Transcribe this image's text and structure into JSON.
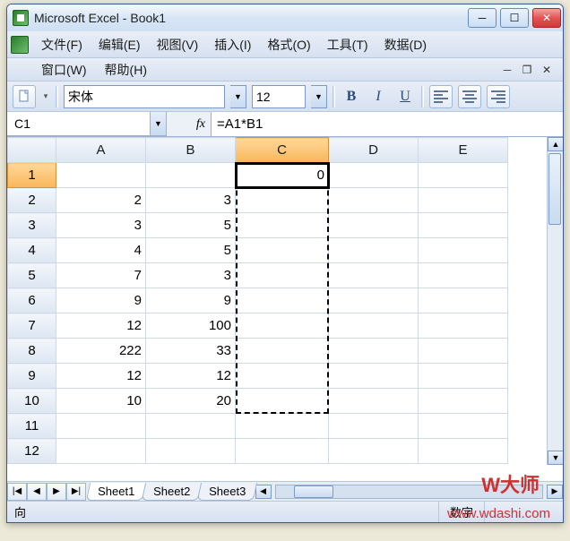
{
  "window": {
    "title": "Microsoft Excel - Book1"
  },
  "menu": {
    "file": "文件(F)",
    "edit": "编辑(E)",
    "view": "视图(V)",
    "insert": "插入(I)",
    "format": "格式(O)",
    "tools": "工具(T)",
    "data": "数据(D)",
    "window": "窗口(W)",
    "help": "帮助(H)"
  },
  "toolbar": {
    "font_name": "宋体",
    "font_size": "12",
    "bold": "B",
    "italic": "I",
    "underline": "U"
  },
  "formula": {
    "namebox": "C1",
    "fx": "fx",
    "value": "=A1*B1"
  },
  "columns": [
    "A",
    "B",
    "C",
    "D",
    "E"
  ],
  "rows": [
    {
      "n": "1",
      "A": "",
      "B": "",
      "C": "0",
      "D": "",
      "E": ""
    },
    {
      "n": "2",
      "A": "2",
      "B": "3",
      "C": "",
      "D": "",
      "E": ""
    },
    {
      "n": "3",
      "A": "3",
      "B": "5",
      "C": "",
      "D": "",
      "E": ""
    },
    {
      "n": "4",
      "A": "4",
      "B": "5",
      "C": "",
      "D": "",
      "E": ""
    },
    {
      "n": "5",
      "A": "7",
      "B": "3",
      "C": "",
      "D": "",
      "E": ""
    },
    {
      "n": "6",
      "A": "9",
      "B": "9",
      "C": "",
      "D": "",
      "E": ""
    },
    {
      "n": "7",
      "A": "12",
      "B": "100",
      "C": "",
      "D": "",
      "E": ""
    },
    {
      "n": "8",
      "A": "222",
      "B": "33",
      "C": "",
      "D": "",
      "E": ""
    },
    {
      "n": "9",
      "A": "12",
      "B": "12",
      "C": "",
      "D": "",
      "E": ""
    },
    {
      "n": "10",
      "A": "10",
      "B": "20",
      "C": "",
      "D": "",
      "E": ""
    },
    {
      "n": "11",
      "A": "",
      "B": "",
      "C": "",
      "D": "",
      "E": ""
    },
    {
      "n": "12",
      "A": "",
      "B": "",
      "C": "",
      "D": "",
      "E": ""
    }
  ],
  "active_cell": {
    "row": 0,
    "col": "C"
  },
  "selected_col": "C",
  "sheets": {
    "nav": [
      "|◀",
      "◀",
      "▶",
      "▶|"
    ],
    "tabs": [
      "Sheet1",
      "Sheet2",
      "Sheet3"
    ],
    "active": 0
  },
  "status": {
    "left": "向",
    "mode": "数字"
  },
  "watermark": {
    "brand": "W大师",
    "url": "www.wdashi.com"
  }
}
